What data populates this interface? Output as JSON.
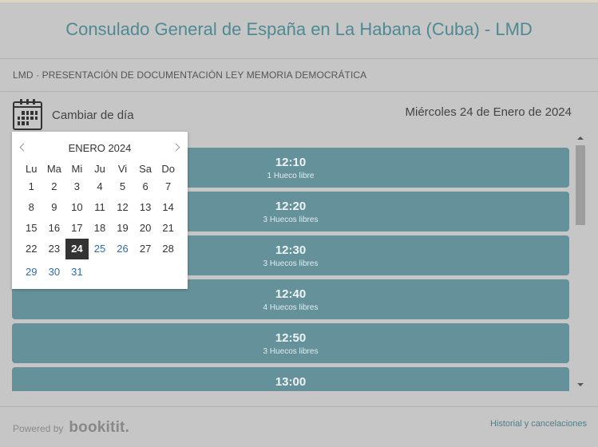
{
  "header": {
    "title": "Consulado General de España en La Habana (Cuba) - LMD"
  },
  "subbar": {
    "text": "LMD · PRESENTACIÓN DE DOCUMENTACIÓN LEY MEMORIA DEMOCRÁTICA"
  },
  "daybar": {
    "change_day_label": "Cambiar de día",
    "current_date": "Miércoles 24 de Enero de 2024"
  },
  "slots": [
    {
      "time": "12:10",
      "free": "1 Hueco libre"
    },
    {
      "time": "12:20",
      "free": "3 Huecos libres"
    },
    {
      "time": "12:30",
      "free": "3 Huecos libres"
    },
    {
      "time": "12:40",
      "free": "4 Huecos libres"
    },
    {
      "time": "12:50",
      "free": "3 Huecos libres"
    },
    {
      "time": "13:00",
      "free": ""
    }
  ],
  "datepicker": {
    "month_title": "ENERO 2024",
    "weekdays": [
      "Lu",
      "Ma",
      "Mi",
      "Ju",
      "Vi",
      "Sa",
      "Do"
    ],
    "weeks": [
      [
        "1",
        "2",
        "3",
        "4",
        "5",
        "6",
        "7"
      ],
      [
        "8",
        "9",
        "10",
        "11",
        "12",
        "13",
        "14"
      ],
      [
        "15",
        "16",
        "17",
        "18",
        "19",
        "20",
        "21"
      ],
      [
        "22",
        "23",
        "24",
        "25",
        "26",
        "27",
        "28"
      ],
      [
        "29",
        "30",
        "31",
        "",
        "",
        "",
        ""
      ]
    ],
    "selected_day": "24",
    "available_days": [
      "25",
      "26",
      "29",
      "30",
      "31"
    ]
  },
  "footer": {
    "powered_by": "Powered by",
    "brand": "bookitit.",
    "history_link": "Historial y cancelaciones"
  },
  "colors": {
    "title": "#4f8a93",
    "slot_bg": "#65929a",
    "available_day": "#2f6aa6",
    "selected_day_bg": "#333333"
  }
}
